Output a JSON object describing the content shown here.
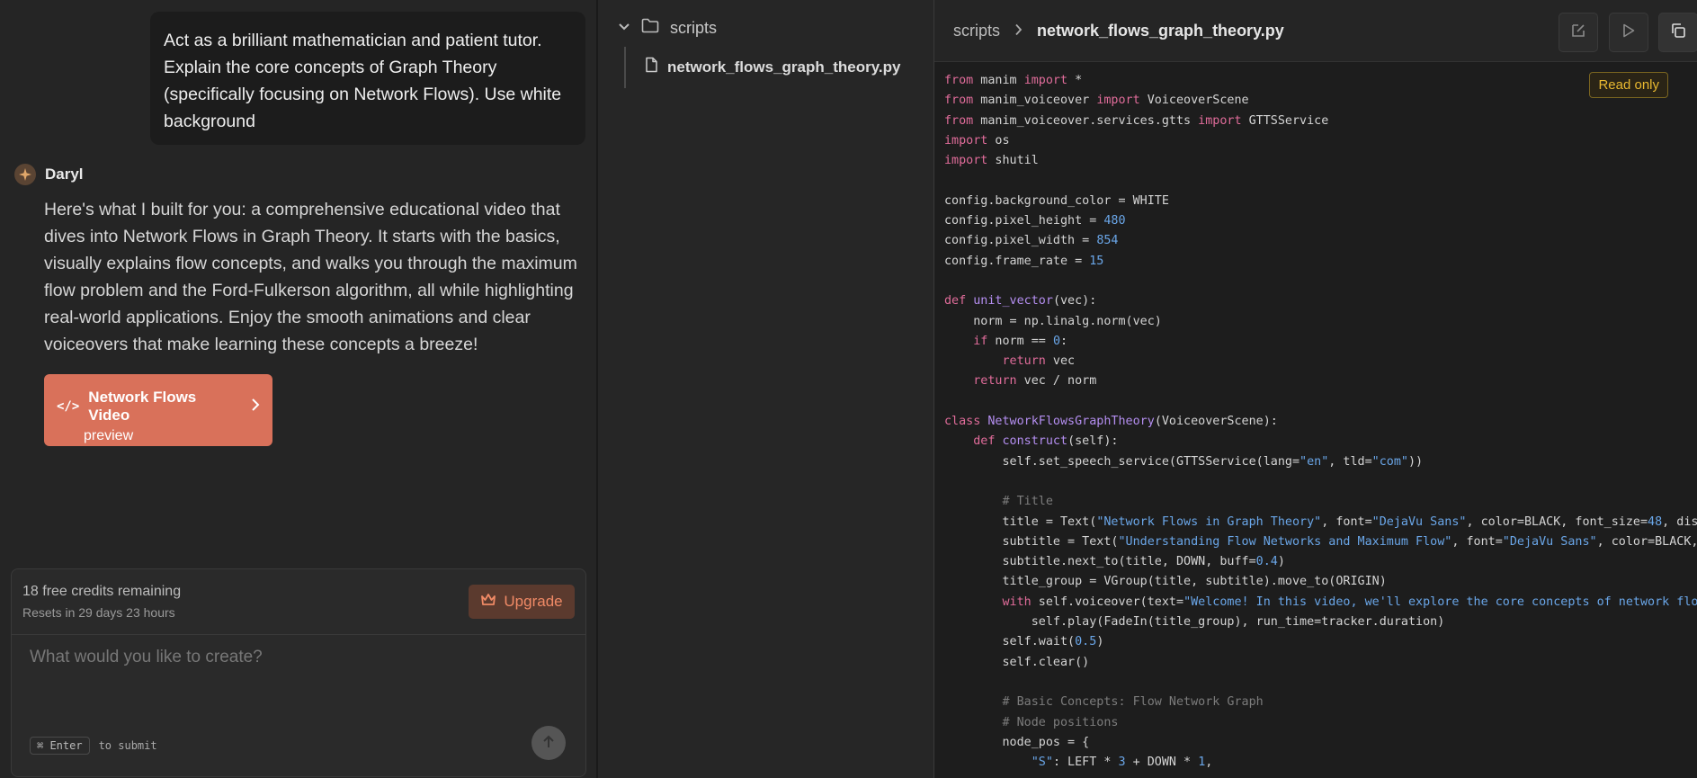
{
  "chat": {
    "user_message": "Act as a brilliant mathematician and patient tutor. Explain the core concepts of Graph Theory (specifically focusing on Network Flows). Use white background",
    "assistant_name": "Daryl",
    "assistant_message": "Here's what I built for you: a comprehensive educational video that dives into Network Flows in Graph Theory. It starts with the basics, visually explains flow concepts, and walks you through the maximum flow problem and the Ford-Fulkerson algorithm, all while highlighting real-world applications. Enjoy the smooth animations and clear voiceovers that make learning these concepts a breeze!",
    "artifact": {
      "icon": "</>",
      "title": "Network Flows Video",
      "subtitle": "preview"
    }
  },
  "composer": {
    "credits_text": "18 free credits remaining",
    "reset_text": "Resets in 29 days 23 hours",
    "upgrade_label": "Upgrade",
    "placeholder": "What would you like to create?",
    "shortcut_key": "⌘ Enter",
    "shortcut_hint": "to submit"
  },
  "file_tree": {
    "folder": "scripts",
    "file": "network_flows_graph_theory.py"
  },
  "editor": {
    "breadcrumb_folder": "scripts",
    "breadcrumb_file": "network_flows_graph_theory.py",
    "readonly_label": "Read only",
    "code_lines": [
      [
        [
          "kw",
          "from"
        ],
        [
          "t",
          " manim "
        ],
        [
          "kw",
          "import"
        ],
        [
          "t",
          " *"
        ]
      ],
      [
        [
          "kw",
          "from"
        ],
        [
          "t",
          " manim_voiceover "
        ],
        [
          "kw",
          "import"
        ],
        [
          "t",
          " VoiceoverScene"
        ]
      ],
      [
        [
          "kw",
          "from"
        ],
        [
          "t",
          " manim_voiceover.services.gtts "
        ],
        [
          "kw",
          "import"
        ],
        [
          "t",
          " GTTSService"
        ]
      ],
      [
        [
          "kw",
          "import"
        ],
        [
          "t",
          " os"
        ]
      ],
      [
        [
          "kw",
          "import"
        ],
        [
          "t",
          " shutil"
        ]
      ],
      [],
      [
        [
          "t",
          "config.background_color = WHITE"
        ]
      ],
      [
        [
          "t",
          "config.pixel_height = "
        ],
        [
          "num",
          "480"
        ]
      ],
      [
        [
          "t",
          "config.pixel_width = "
        ],
        [
          "num",
          "854"
        ]
      ],
      [
        [
          "t",
          "config.frame_rate = "
        ],
        [
          "num",
          "15"
        ]
      ],
      [],
      [
        [
          "kw",
          "def"
        ],
        [
          "t",
          " "
        ],
        [
          "fn",
          "unit_vector"
        ],
        [
          "t",
          "(vec):"
        ]
      ],
      [
        [
          "t",
          "    norm = np.linalg.norm(vec)"
        ]
      ],
      [
        [
          "t",
          "    "
        ],
        [
          "kw",
          "if"
        ],
        [
          "t",
          " norm == "
        ],
        [
          "num",
          "0"
        ],
        [
          "t",
          ":"
        ]
      ],
      [
        [
          "t",
          "        "
        ],
        [
          "kw",
          "return"
        ],
        [
          "t",
          " vec"
        ]
      ],
      [
        [
          "t",
          "    "
        ],
        [
          "kw",
          "return"
        ],
        [
          "t",
          " vec / norm"
        ]
      ],
      [],
      [
        [
          "kw",
          "class"
        ],
        [
          "t",
          " "
        ],
        [
          "fn",
          "NetworkFlowsGraphTheory"
        ],
        [
          "t",
          "(VoiceoverScene):"
        ]
      ],
      [
        [
          "t",
          "    "
        ],
        [
          "kw",
          "def"
        ],
        [
          "t",
          " "
        ],
        [
          "fn",
          "construct"
        ],
        [
          "t",
          "(self):"
        ]
      ],
      [
        [
          "t",
          "        self.set_speech_service(GTTSService(lang="
        ],
        [
          "str",
          "\"en\""
        ],
        [
          "t",
          ", tld="
        ],
        [
          "str",
          "\"com\""
        ],
        [
          "t",
          "))"
        ]
      ],
      [],
      [
        [
          "t",
          "        "
        ],
        [
          "cm",
          "# Title"
        ]
      ],
      [
        [
          "t",
          "        title = Text("
        ],
        [
          "str",
          "\"Network Flows in Graph Theory\""
        ],
        [
          "t",
          ", font="
        ],
        [
          "str",
          "\"DejaVu Sans\""
        ],
        [
          "t",
          ", color=BLACK, font_size="
        ],
        [
          "num",
          "48"
        ],
        [
          "t",
          ", disa"
        ]
      ],
      [
        [
          "t",
          "        subtitle = Text("
        ],
        [
          "str",
          "\"Understanding Flow Networks and Maximum Flow\""
        ],
        [
          "t",
          ", font="
        ],
        [
          "str",
          "\"DejaVu Sans\""
        ],
        [
          "t",
          ", color=BLACK,"
        ]
      ],
      [
        [
          "t",
          "        subtitle.next_to(title, DOWN, buff="
        ],
        [
          "num",
          "0.4"
        ],
        [
          "t",
          ")"
        ]
      ],
      [
        [
          "t",
          "        title_group = VGroup(title, subtitle).move_to(ORIGIN)"
        ]
      ],
      [
        [
          "t",
          "        "
        ],
        [
          "kw",
          "with"
        ],
        [
          "t",
          " self.voiceover(text="
        ],
        [
          "str",
          "\"Welcome! In this video, we'll explore the core concepts of network flow"
        ]
      ],
      [
        [
          "t",
          "            self.play(FadeIn(title_group), run_time=tracker.duration)"
        ]
      ],
      [
        [
          "t",
          "        self.wait("
        ],
        [
          "num",
          "0.5"
        ],
        [
          "t",
          ")"
        ]
      ],
      [
        [
          "t",
          "        self.clear()"
        ]
      ],
      [],
      [
        [
          "t",
          "        "
        ],
        [
          "cm",
          "# Basic Concepts: Flow Network Graph"
        ]
      ],
      [
        [
          "t",
          "        "
        ],
        [
          "cm",
          "# Node positions"
        ]
      ],
      [
        [
          "t",
          "        node_pos = {"
        ]
      ],
      [
        [
          "t",
          "            "
        ],
        [
          "str",
          "\"S\""
        ],
        [
          "t",
          ": LEFT * "
        ],
        [
          "num",
          "3"
        ],
        [
          "t",
          " + DOWN * "
        ],
        [
          "num",
          "1"
        ],
        [
          "t",
          ","
        ]
      ]
    ],
    "syntax_colors": {
      "kw": "#e06c9a",
      "fn": "#b48ef0",
      "str": "#6aa6e8",
      "num": "#6aa6e8",
      "cm": "#7c7c7c",
      "t": "#d4d4d4"
    }
  }
}
